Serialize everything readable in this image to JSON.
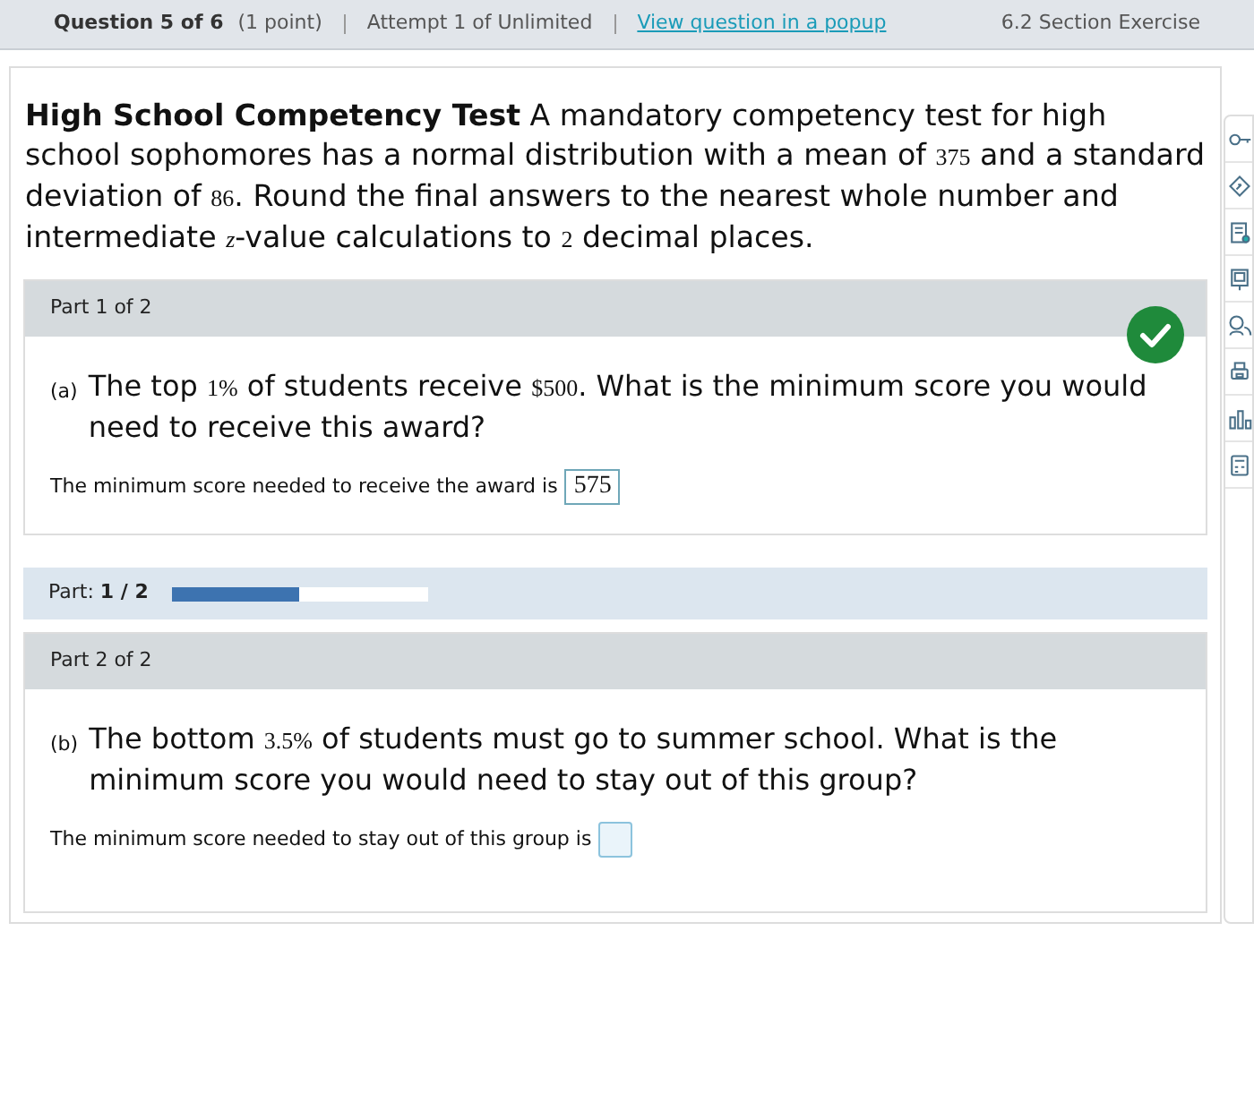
{
  "header": {
    "question": "Question 5 of 6",
    "points": "(1 point)",
    "attempt": "Attempt 1 of Unlimited",
    "popup_link": "View question in a popup",
    "section": "6.2 Section Exercise"
  },
  "intro": [
    {
      "kind": "bold",
      "text": "High School Competency Test"
    },
    {
      "kind": "text",
      "text": " A mandatory competency test for high school sophomores has a normal distribution with a mean of "
    },
    {
      "kind": "math",
      "text": "375"
    },
    {
      "kind": "text",
      "text": " and a standard deviation of "
    },
    {
      "kind": "math",
      "text": "86"
    },
    {
      "kind": "text",
      "text": ". Round the final answers to the nearest whole number and intermediate "
    },
    {
      "kind": "math",
      "text": "z"
    },
    {
      "kind": "text",
      "text": "-value calculations to "
    },
    {
      "kind": "math",
      "text": "2"
    },
    {
      "kind": "text",
      "text": " decimal places."
    }
  ],
  "parts": [
    {
      "title": "Part 1 of 2",
      "correct": true,
      "letter": "(a)",
      "question": [
        {
          "kind": "text",
          "text": "The top "
        },
        {
          "kind": "math",
          "text": "1%"
        },
        {
          "kind": "text",
          "text": " of students receive "
        },
        {
          "kind": "math",
          "text": "$500"
        },
        {
          "kind": "text",
          "text": ". What is the minimum score you would need to receive this award?"
        }
      ],
      "answer_prefix": "The minimum score needed to receive the award is",
      "answer": "575"
    },
    {
      "title": "Part 2 of 2",
      "correct": false,
      "letter": "(b)",
      "question": [
        {
          "kind": "text",
          "text": "The bottom "
        },
        {
          "kind": "math",
          "text": "3.5%"
        },
        {
          "kind": "text",
          "text": " of students must go to summer school. What is the minimum score you would need to stay out of this group?"
        }
      ],
      "answer_prefix": "The minimum score needed to stay out of this group is"
    }
  ],
  "progress": {
    "label": "Part:",
    "value": "1 / 2",
    "level": 0.5
  }
}
